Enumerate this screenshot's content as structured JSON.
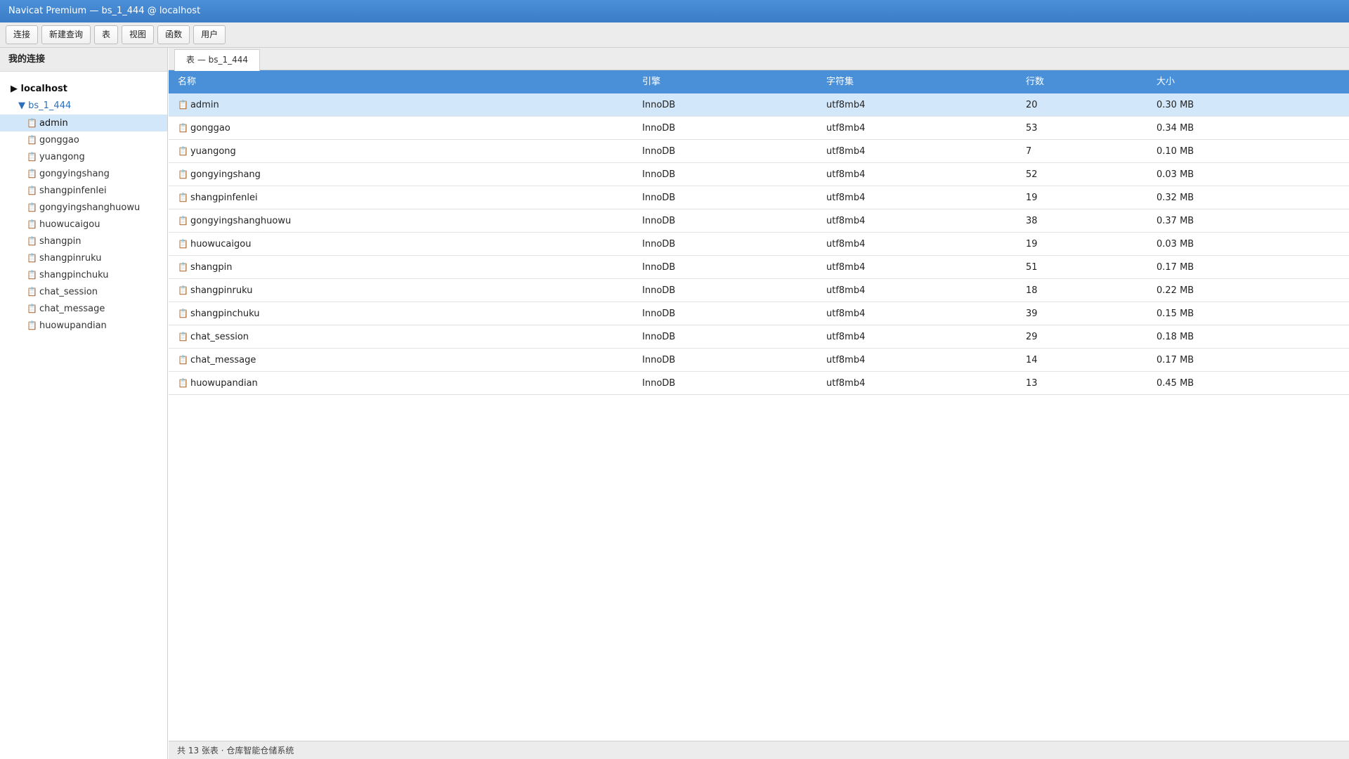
{
  "window": {
    "title": "Navicat Premium — bs_1_444 @ localhost"
  },
  "toolbar": {
    "buttons": [
      "连接",
      "新建查询",
      "表",
      "视图",
      "函数",
      "用户"
    ]
  },
  "sidebar": {
    "header": "我的连接",
    "server": "localhost",
    "database": "bs_1_444",
    "server_arrow": "▶",
    "db_arrow": "▼",
    "tables": [
      "admin",
      "gonggao",
      "yuangong",
      "gongyingshang",
      "shangpinfenlei",
      "gongyingshanghuowu",
      "huowucaigou",
      "shangpin",
      "shangpinruku",
      "shangpinchuku",
      "chat_session",
      "chat_message",
      "huowupandian"
    ],
    "selected_table": "admin"
  },
  "main": {
    "tab_label": "表 — bs_1_444",
    "columns": [
      "名称",
      "引擎",
      "字符集",
      "行数",
      "大小"
    ],
    "rows": [
      {
        "name": "admin",
        "engine": "InnoDB",
        "charset": "utf8mb4",
        "rows": "20",
        "size": "0.30 MB"
      },
      {
        "name": "gonggao",
        "engine": "InnoDB",
        "charset": "utf8mb4",
        "rows": "53",
        "size": "0.34 MB"
      },
      {
        "name": "yuangong",
        "engine": "InnoDB",
        "charset": "utf8mb4",
        "rows": "7",
        "size": "0.10 MB"
      },
      {
        "name": "gongyingshang",
        "engine": "InnoDB",
        "charset": "utf8mb4",
        "rows": "52",
        "size": "0.03 MB"
      },
      {
        "name": "shangpinfenlei",
        "engine": "InnoDB",
        "charset": "utf8mb4",
        "rows": "19",
        "size": "0.32 MB"
      },
      {
        "name": "gongyingshanghuowu",
        "engine": "InnoDB",
        "charset": "utf8mb4",
        "rows": "38",
        "size": "0.37 MB"
      },
      {
        "name": "huowucaigou",
        "engine": "InnoDB",
        "charset": "utf8mb4",
        "rows": "19",
        "size": "0.03 MB"
      },
      {
        "name": "shangpin",
        "engine": "InnoDB",
        "charset": "utf8mb4",
        "rows": "51",
        "size": "0.17 MB"
      },
      {
        "name": "shangpinruku",
        "engine": "InnoDB",
        "charset": "utf8mb4",
        "rows": "18",
        "size": "0.22 MB"
      },
      {
        "name": "shangpinchuku",
        "engine": "InnoDB",
        "charset": "utf8mb4",
        "rows": "39",
        "size": "0.15 MB"
      },
      {
        "name": "chat_session",
        "engine": "InnoDB",
        "charset": "utf8mb4",
        "rows": "29",
        "size": "0.18 MB"
      },
      {
        "name": "chat_message",
        "engine": "InnoDB",
        "charset": "utf8mb4",
        "rows": "14",
        "size": "0.17 MB"
      },
      {
        "name": "huowupandian",
        "engine": "InnoDB",
        "charset": "utf8mb4",
        "rows": "13",
        "size": "0.45 MB"
      }
    ]
  },
  "status": {
    "text": "共 13 张表 · 仓库智能仓储系统"
  },
  "icons": {
    "table": "clipboard-icon"
  },
  "colors": {
    "accent": "#4a90d8",
    "selection": "#d3e7fb",
    "db_link": "#2e6fba"
  }
}
